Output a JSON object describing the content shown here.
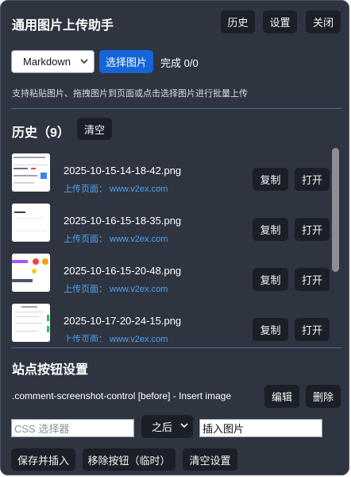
{
  "header": {
    "title": "通用图片上传助手",
    "history_btn": "历史",
    "settings_btn": "设置",
    "close_btn": "关闭"
  },
  "toolbar": {
    "format_selected": "Markdown",
    "choose_image_btn": "选择图片",
    "progress": "完成 0/0",
    "hint": "支持粘贴图片、拖拽图片到页面或点击选择图片进行批量上传"
  },
  "history": {
    "heading": "历史（9）",
    "clear_btn": "清空",
    "items": [
      {
        "filename": "2025-10-15-14-18-42.png",
        "source_label": "上传页面：",
        "source_value": "www.v2ex.com",
        "copy_label": "复制",
        "open_label": "打开"
      },
      {
        "filename": "2025-10-16-15-18-35.png",
        "source_label": "上传页面：",
        "source_value": "www.v2ex.com",
        "copy_label": "复制",
        "open_label": "打开"
      },
      {
        "filename": "2025-10-16-15-20-48.png",
        "source_label": "上传页面：",
        "source_value": "www.v2ex.com",
        "copy_label": "复制",
        "open_label": "打开"
      },
      {
        "filename": "2025-10-17-20-24-15.png",
        "source_label": "上传页面：",
        "source_value": "www.v2ex.com",
        "copy_label": "复制",
        "open_label": "打开"
      }
    ]
  },
  "site_settings": {
    "heading": "站点按钮设置",
    "rule": ".comment-screenshot-control [before] - Insert image",
    "edit_btn": "编辑",
    "delete_btn": "删除",
    "selector_placeholder": "CSS 选择器",
    "position_selected": "之后",
    "button_text_value": "插入图片",
    "save_insert_btn": "保存并插入",
    "remove_temp_btn": "移除按钮（临时）",
    "clear_settings_btn": "清空设置"
  },
  "colors": {
    "panel_bg": "#2f3441",
    "button_bg": "#1b1f27",
    "primary": "#1565d8",
    "link": "#4ea3f2"
  }
}
